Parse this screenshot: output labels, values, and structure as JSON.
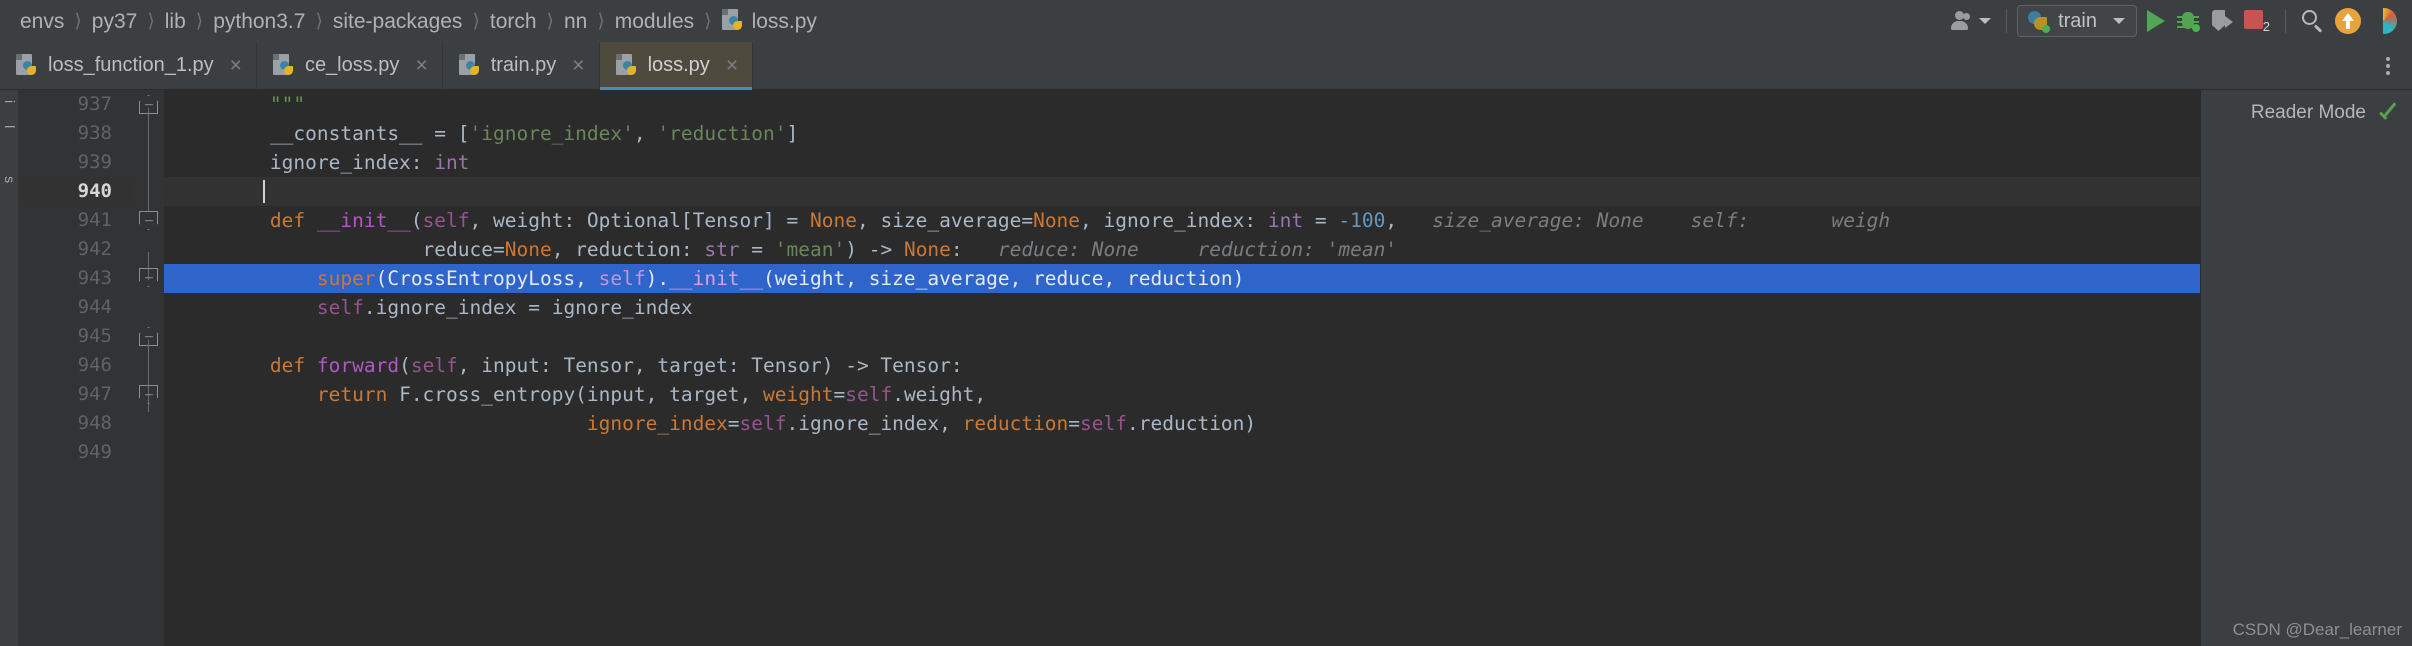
{
  "navbar": {
    "breadcrumbs": [
      {
        "label": "envs",
        "icon": null
      },
      {
        "label": "py37",
        "icon": null
      },
      {
        "label": "lib",
        "icon": null
      },
      {
        "label": "python3.7",
        "icon": null
      },
      {
        "label": "site-packages",
        "icon": null
      },
      {
        "label": "torch",
        "icon": null
      },
      {
        "label": "nn",
        "icon": null
      },
      {
        "label": "modules",
        "icon": null
      },
      {
        "label": "loss.py",
        "icon": "python-file-icon"
      }
    ],
    "separator": "〉",
    "toolbar": {
      "user_icon": "users-icon",
      "user_caret": "chevron-down-icon",
      "run_config_label": "train",
      "run_config_icon": "python-config-icon",
      "run_config_caret": "chevron-down-icon",
      "run_icon": "run-play-icon",
      "debug_icon": "debug-bug-icon",
      "coverage_icon": "run-with-coverage-icon",
      "stop_icon": "stop-square-icon",
      "stop_badge": "2",
      "search_icon": "search-icon",
      "update_icon": "update-project-icon",
      "rainbow_icon": "ide-feature-icon"
    }
  },
  "tabs": {
    "items": [
      {
        "label": "loss_function_1.py",
        "icon": "python-file-icon",
        "close": "×",
        "active": false
      },
      {
        "label": "ce_loss.py",
        "icon": "python-file-icon",
        "close": "×",
        "active": false
      },
      {
        "label": "train.py",
        "icon": "python-file-icon",
        "close": "×",
        "active": false
      },
      {
        "label": "loss.py",
        "icon": "python-file-icon",
        "close": "×",
        "active": true
      }
    ],
    "overflow_icon": "more-vertical-icon"
  },
  "left_strip": {
    "labels": "il s"
  },
  "editor": {
    "reader_mode_label": "Reader Mode",
    "inspection_icon": "inspections-ok-icon",
    "first_line_number": 937,
    "current_line": 940,
    "selected_line": 943,
    "lines": [
      {
        "num": "937",
        "text": "        \"\"\""
      },
      {
        "num": "938",
        "text": "        __constants__ = ['ignore_index', 'reduction']"
      },
      {
        "num": "939",
        "text": "        ignore_index: int"
      },
      {
        "num": "940",
        "text": ""
      },
      {
        "num": "941",
        "text": "        def __init__(self, weight: Optional[Tensor] = None, size_average=None, ignore_index: int = -100,"
      },
      {
        "num": "942",
        "text": "                     reduce=None, reduction: str = 'mean') -> None:"
      },
      {
        "num": "943",
        "text": "            super(CrossEntropyLoss, self).__init__(weight, size_average, reduce, reduction)"
      },
      {
        "num": "944",
        "text": "            self.ignore_index = ignore_index"
      },
      {
        "num": "945",
        "text": ""
      },
      {
        "num": "946",
        "text": "        def forward(self, input: Tensor, target: Tensor) -> Tensor:"
      },
      {
        "num": "947",
        "text": "            return F.cross_entropy(input, target, weight=self.weight,"
      },
      {
        "num": "948",
        "text": "                                   ignore_index=self.ignore_index, reduction=self.reduction)"
      },
      {
        "num": "949",
        "text": ""
      }
    ],
    "inlay_hints": {
      "line_941": [
        "size_average: None",
        "self:",
        "weigh"
      ],
      "line_942": [
        "reduce: None",
        "reduction: 'mean'"
      ]
    }
  },
  "watermark": "CSDN @Dear_learner",
  "colors": {
    "editor_bg": "#2b2b2b",
    "chrome_bg": "#3c3f41",
    "gutter_bg": "#313335",
    "selection_blue": "#2f65ca",
    "active_tab_bg": "#4e4a3d",
    "tab_underline": "#4a88c7",
    "keyword_orange": "#cc7832",
    "string_green": "#6a8759",
    "number_blue": "#6897bb",
    "type_violet": "#9876aa",
    "func_magenta": "#b256c8",
    "text_grey": "#a9b7c6",
    "hint_grey": "#7a7d80"
  }
}
